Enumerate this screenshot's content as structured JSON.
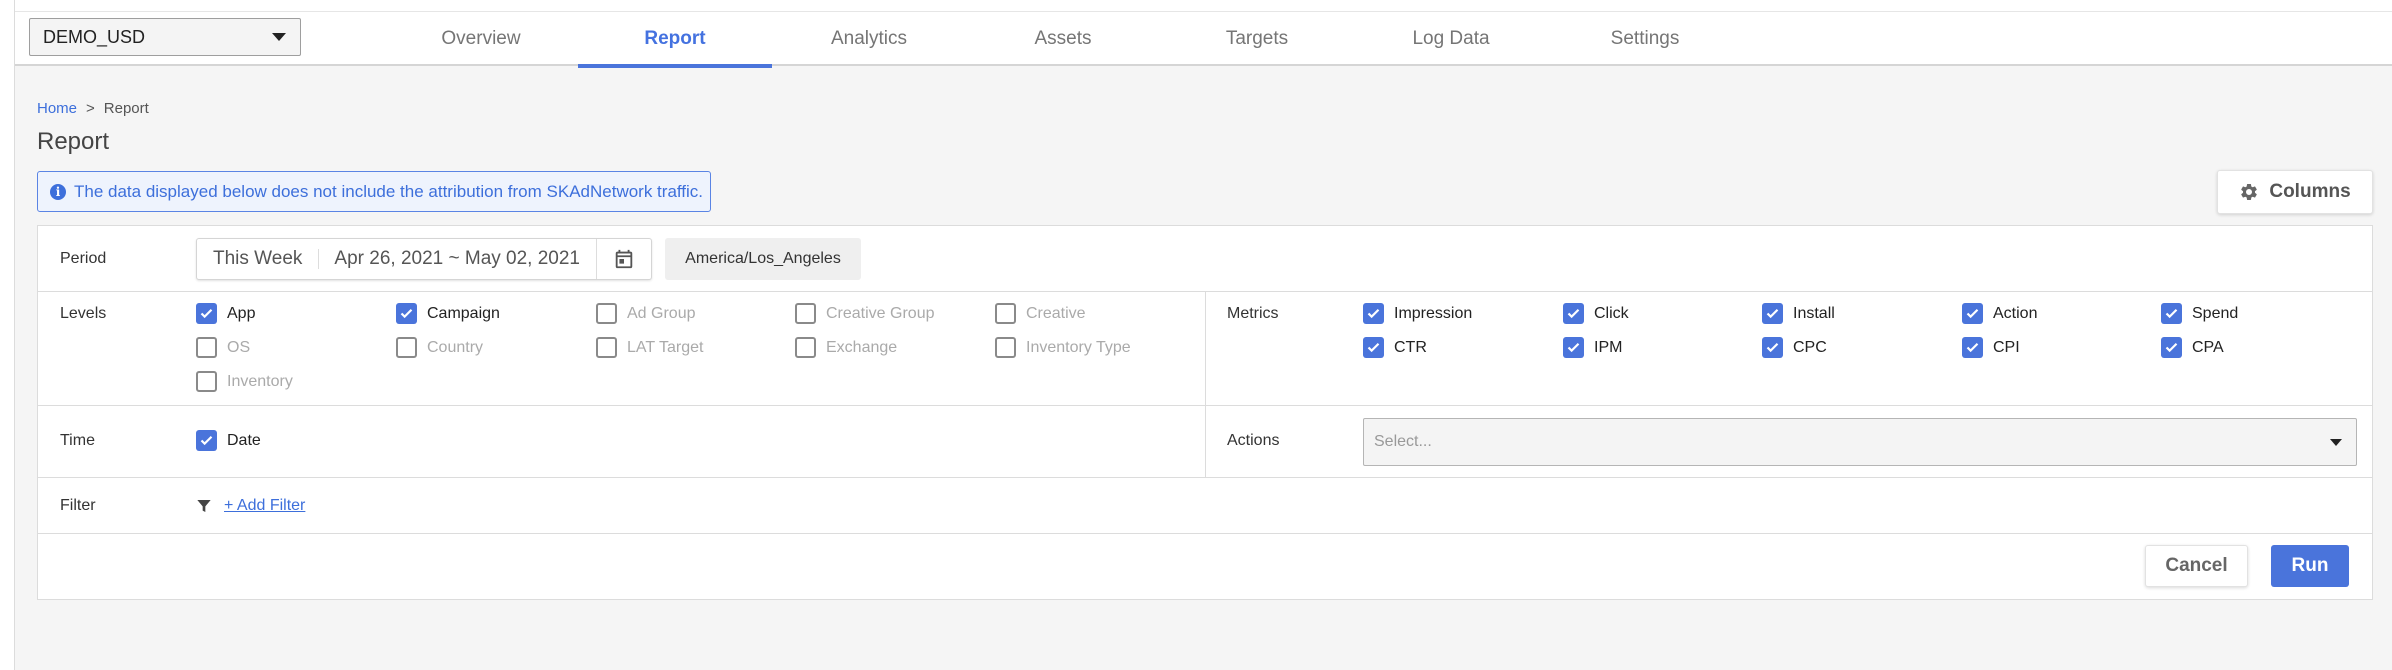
{
  "account": {
    "selected": "DEMO_USD"
  },
  "nav": {
    "tabs": [
      {
        "label": "Overview",
        "active": false
      },
      {
        "label": "Report",
        "active": true
      },
      {
        "label": "Analytics",
        "active": false
      },
      {
        "label": "Assets",
        "active": false
      },
      {
        "label": "Targets",
        "active": false
      },
      {
        "label": "Log Data",
        "active": false
      },
      {
        "label": "Settings",
        "active": false
      }
    ]
  },
  "breadcrumb": {
    "home": "Home",
    "separator": ">",
    "current": "Report"
  },
  "page_title": "Report",
  "notice": {
    "text": "The data displayed below does not include the attribution from SKAdNetwork traffic.",
    "icon": "info-icon"
  },
  "columns_button": {
    "label": "Columns",
    "icon": "gear-icon"
  },
  "period": {
    "label": "Period",
    "preset": "This Week",
    "range": "Apr 26, 2021 ~ May 02, 2021",
    "timezone": "America/Los_Angeles"
  },
  "levels": {
    "label": "Levels",
    "items": [
      {
        "label": "App",
        "checked": true
      },
      {
        "label": "Campaign",
        "checked": true
      },
      {
        "label": "Ad Group",
        "checked": false
      },
      {
        "label": "Creative Group",
        "checked": false
      },
      {
        "label": "Creative",
        "checked": false
      },
      {
        "label": "OS",
        "checked": false
      },
      {
        "label": "Country",
        "checked": false
      },
      {
        "label": "LAT Target",
        "checked": false
      },
      {
        "label": "Exchange",
        "checked": false
      },
      {
        "label": "Inventory Type",
        "checked": false
      },
      {
        "label": "Inventory",
        "checked": false
      }
    ]
  },
  "metrics": {
    "label": "Metrics",
    "items": [
      {
        "label": "Impression",
        "checked": true
      },
      {
        "label": "Click",
        "checked": true
      },
      {
        "label": "Install",
        "checked": true
      },
      {
        "label": "Action",
        "checked": true
      },
      {
        "label": "Spend",
        "checked": true
      },
      {
        "label": "CTR",
        "checked": true
      },
      {
        "label": "IPM",
        "checked": true
      },
      {
        "label": "CPC",
        "checked": true
      },
      {
        "label": "CPI",
        "checked": true
      },
      {
        "label": "CPA",
        "checked": true
      }
    ]
  },
  "time": {
    "label": "Time",
    "items": [
      {
        "label": "Date",
        "checked": true
      }
    ]
  },
  "actions": {
    "label": "Actions",
    "placeholder": "Select..."
  },
  "filter": {
    "label": "Filter",
    "add_label": "+ Add Filter"
  },
  "buttons": {
    "cancel": "Cancel",
    "run": "Run"
  },
  "colors": {
    "accent": "#4a74db",
    "link": "#3d6fdb"
  }
}
